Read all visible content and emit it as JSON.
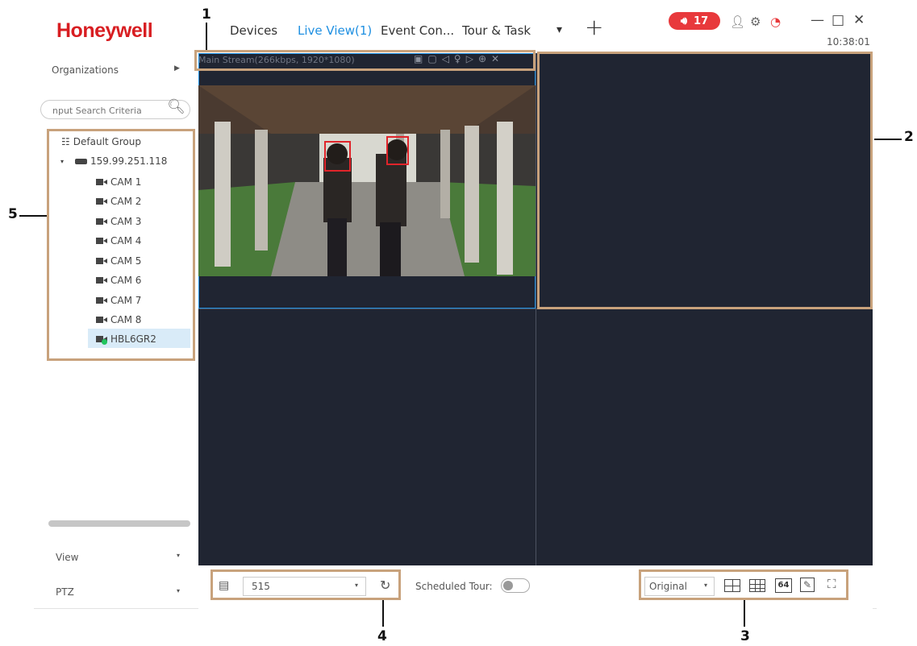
{
  "header": {
    "logo": "Honeywell",
    "tabs": [
      "Devices",
      "Live View(1)",
      "Event Con...",
      "Tour & Task"
    ],
    "more_label": "▾",
    "add_label": "+",
    "alarm_count": "17",
    "time": "10:38:01"
  },
  "sidebar": {
    "organizations_label": "Organizations",
    "search": {
      "placeholder": "nput Search Criteria"
    },
    "tree": {
      "group": "Default Group",
      "device": "159.99.251.118",
      "cameras": [
        "CAM 1",
        "CAM 2",
        "CAM 3",
        "CAM 4",
        "CAM 5",
        "CAM 6",
        "CAM 7",
        "CAM 8"
      ],
      "selected_camera": "HBL6GR2"
    },
    "panels": [
      "View",
      "PTZ"
    ]
  },
  "video": {
    "stream_info": "Main Stream(266kbps, 1920*1080)"
  },
  "toolbar": {
    "view_select": "515",
    "scheduled_tour_label": "Scheduled Tour:",
    "scheduled_tour_on": false,
    "aspect_select": "Original",
    "split_64_label": "64"
  },
  "annotations": [
    "1",
    "2",
    "3",
    "4",
    "5"
  ],
  "colors": {
    "brand": "#d81e22",
    "accent": "#1e8fe1",
    "alarm": "#e8393c",
    "video_bg": "#202532",
    "callout": "#c8a27c"
  }
}
